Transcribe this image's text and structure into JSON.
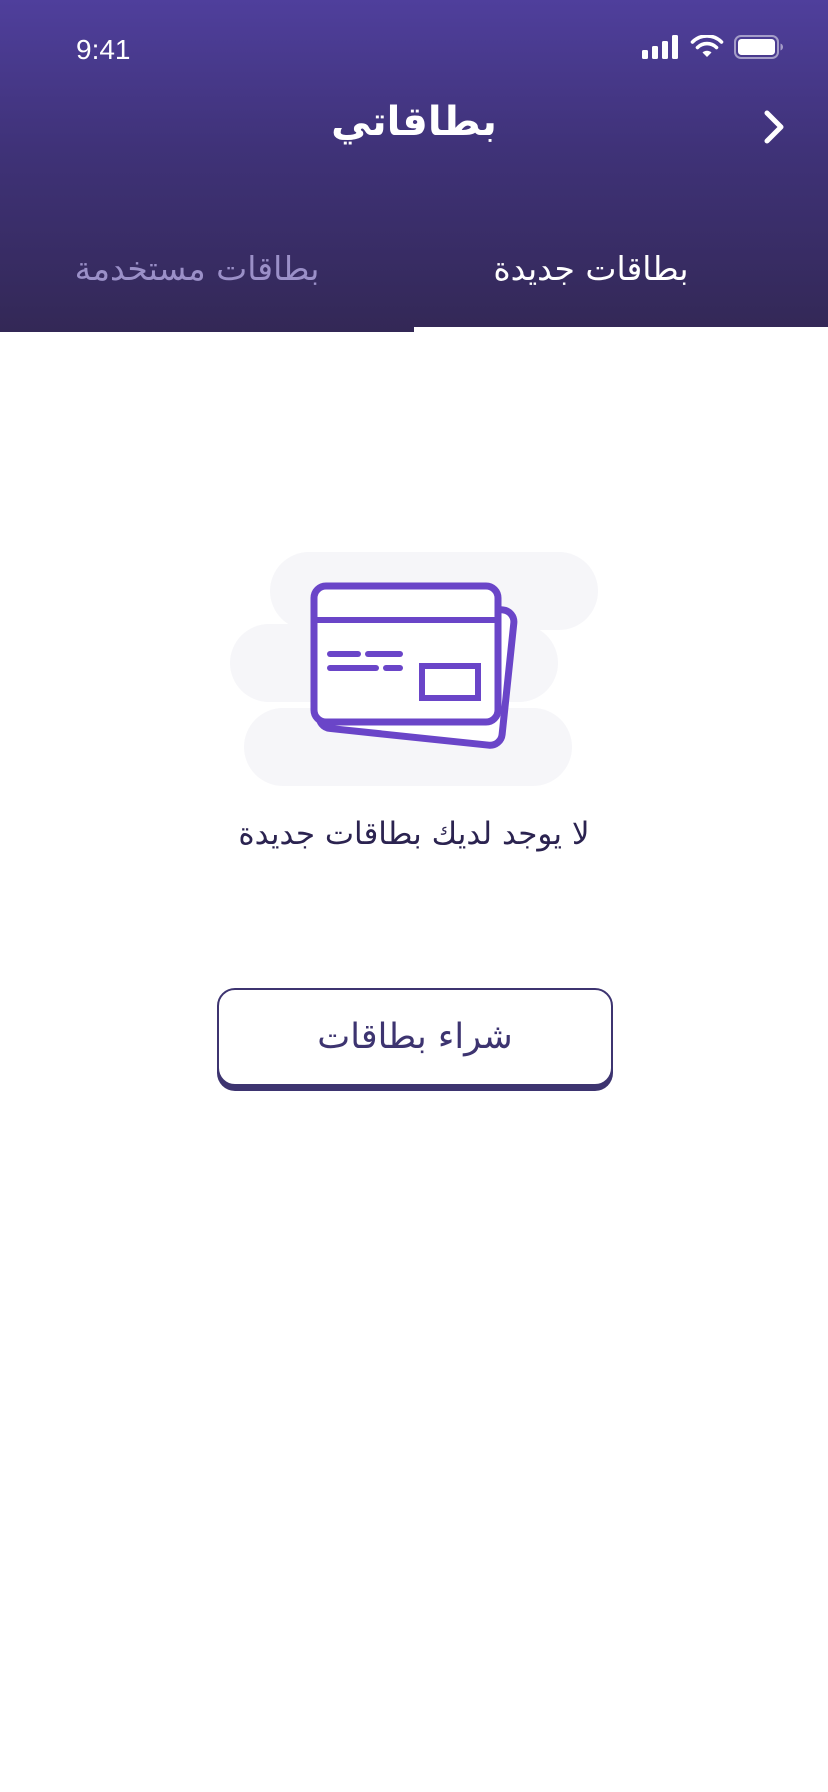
{
  "status_bar": {
    "time": "9:41"
  },
  "header": {
    "title": "بطاقاتي",
    "back_icon": "chevron-right-icon"
  },
  "tabs": [
    {
      "label": "بطاقات جديدة",
      "active": true
    },
    {
      "label": "بطاقات مستخدمة",
      "active": false
    }
  ],
  "empty_state": {
    "icon": "credit-cards-icon",
    "message": "لا يوجد لديك بطاقات جديدة"
  },
  "actions": {
    "buy_label": "شراء بطاقات"
  },
  "colors": {
    "header_top": "#4f3f9c",
    "header_bottom": "#332856",
    "accent": "#6a45c8",
    "button_border": "#3d3470",
    "inactive_tab": "#9b90c8"
  }
}
